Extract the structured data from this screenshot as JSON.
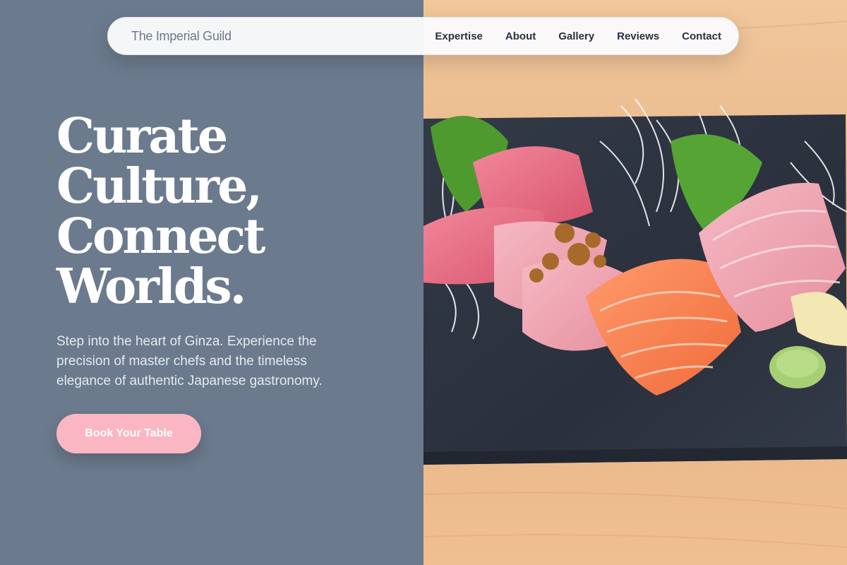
{
  "nav": {
    "brand": "The Imperial Guild",
    "links": [
      "Expertise",
      "About",
      "Gallery",
      "Reviews",
      "Contact"
    ]
  },
  "hero": {
    "title_lines": [
      "Curate",
      "Culture,",
      "Connect",
      "Worlds."
    ],
    "description": "Step into the heart of Ginza. Experience the precision of master chefs and the timeless elegance of authentic Japanese gastronomy.",
    "cta_label": "Book Your Table"
  },
  "image": {
    "subject": "sashimi platter on slate plate"
  },
  "colors": {
    "panel": "#6b7a8d",
    "cta": "#fbb6c4",
    "nav_text": "#2b3140",
    "wood": "#e9b98a",
    "slate": "#2a313d"
  }
}
